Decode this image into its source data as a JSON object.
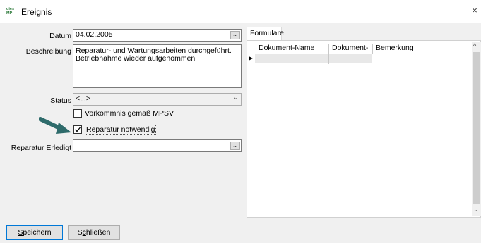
{
  "window": {
    "title": "Ereignis",
    "logo_text_top": "dies",
    "logo_text_bottom": "MP",
    "close_glyph": "×"
  },
  "form": {
    "datum_label": "Datum",
    "datum_value": "04.02.2005",
    "beschreibung_label": "Beschreibung",
    "beschreibung_line1": "Reparatur- und Wartungsarbeiten durchgeführt.",
    "beschreibung_line2": "Betriebnahme wieder aufgenommen",
    "status_label": "Status",
    "status_value": "<...>",
    "checkbox_mpsv_label": "Vorkommnis gemäß MPSV",
    "checkbox_mpsv_checked": false,
    "checkbox_reparatur_label": "Reparatur notwendig",
    "checkbox_reparatur_checked": true,
    "reparatur_erledigt_label": "Reparatur Erledigt",
    "reparatur_erledigt_value": "",
    "ellipsis": "...",
    "dropdown_glyph": "⌄"
  },
  "tabs": [
    {
      "label": "Formulare",
      "active": true
    }
  ],
  "grid": {
    "columns": [
      "Dokument-Name",
      "Dokument-Art",
      "Bemerkung"
    ],
    "row_indicator": "▶",
    "scroll_up": "^",
    "scroll_down": "⌄"
  },
  "buttons": {
    "save_accel": "S",
    "save_rest": "peichern",
    "close_first": "S",
    "close_accel": "c",
    "close_rest": "hließen"
  },
  "colors": {
    "annotation_arrow": "#2e6b6b",
    "default_button_border": "#0078d7"
  },
  "icons": {
    "annotation": "arrow-pointer-icon",
    "checkmark": "checkmark-icon"
  }
}
